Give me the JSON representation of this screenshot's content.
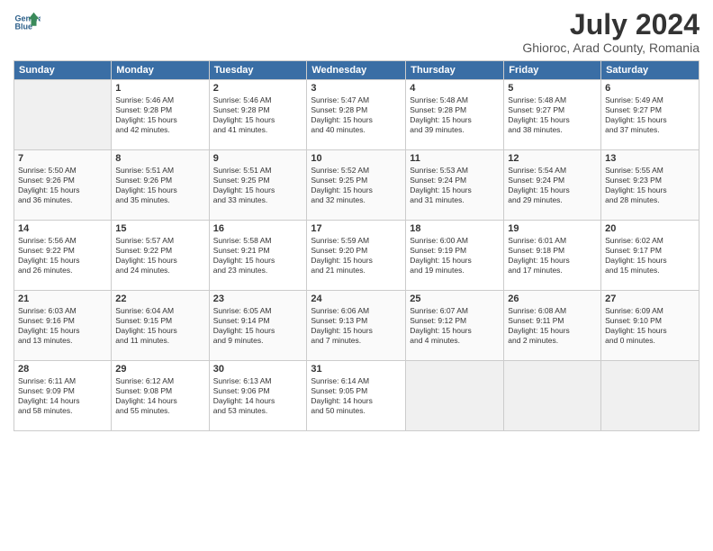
{
  "header": {
    "logo_line1": "General",
    "logo_line2": "Blue",
    "title": "July 2024",
    "subtitle": "Ghioroc, Arad County, Romania"
  },
  "days_of_week": [
    "Sunday",
    "Monday",
    "Tuesday",
    "Wednesday",
    "Thursday",
    "Friday",
    "Saturday"
  ],
  "weeks": [
    [
      {
        "day": "",
        "info": ""
      },
      {
        "day": "1",
        "info": "Sunrise: 5:46 AM\nSunset: 9:28 PM\nDaylight: 15 hours\nand 42 minutes."
      },
      {
        "day": "2",
        "info": "Sunrise: 5:46 AM\nSunset: 9:28 PM\nDaylight: 15 hours\nand 41 minutes."
      },
      {
        "day": "3",
        "info": "Sunrise: 5:47 AM\nSunset: 9:28 PM\nDaylight: 15 hours\nand 40 minutes."
      },
      {
        "day": "4",
        "info": "Sunrise: 5:48 AM\nSunset: 9:28 PM\nDaylight: 15 hours\nand 39 minutes."
      },
      {
        "day": "5",
        "info": "Sunrise: 5:48 AM\nSunset: 9:27 PM\nDaylight: 15 hours\nand 38 minutes."
      },
      {
        "day": "6",
        "info": "Sunrise: 5:49 AM\nSunset: 9:27 PM\nDaylight: 15 hours\nand 37 minutes."
      }
    ],
    [
      {
        "day": "7",
        "info": "Sunrise: 5:50 AM\nSunset: 9:26 PM\nDaylight: 15 hours\nand 36 minutes."
      },
      {
        "day": "8",
        "info": "Sunrise: 5:51 AM\nSunset: 9:26 PM\nDaylight: 15 hours\nand 35 minutes."
      },
      {
        "day": "9",
        "info": "Sunrise: 5:51 AM\nSunset: 9:25 PM\nDaylight: 15 hours\nand 33 minutes."
      },
      {
        "day": "10",
        "info": "Sunrise: 5:52 AM\nSunset: 9:25 PM\nDaylight: 15 hours\nand 32 minutes."
      },
      {
        "day": "11",
        "info": "Sunrise: 5:53 AM\nSunset: 9:24 PM\nDaylight: 15 hours\nand 31 minutes."
      },
      {
        "day": "12",
        "info": "Sunrise: 5:54 AM\nSunset: 9:24 PM\nDaylight: 15 hours\nand 29 minutes."
      },
      {
        "day": "13",
        "info": "Sunrise: 5:55 AM\nSunset: 9:23 PM\nDaylight: 15 hours\nand 28 minutes."
      }
    ],
    [
      {
        "day": "14",
        "info": "Sunrise: 5:56 AM\nSunset: 9:22 PM\nDaylight: 15 hours\nand 26 minutes."
      },
      {
        "day": "15",
        "info": "Sunrise: 5:57 AM\nSunset: 9:22 PM\nDaylight: 15 hours\nand 24 minutes."
      },
      {
        "day": "16",
        "info": "Sunrise: 5:58 AM\nSunset: 9:21 PM\nDaylight: 15 hours\nand 23 minutes."
      },
      {
        "day": "17",
        "info": "Sunrise: 5:59 AM\nSunset: 9:20 PM\nDaylight: 15 hours\nand 21 minutes."
      },
      {
        "day": "18",
        "info": "Sunrise: 6:00 AM\nSunset: 9:19 PM\nDaylight: 15 hours\nand 19 minutes."
      },
      {
        "day": "19",
        "info": "Sunrise: 6:01 AM\nSunset: 9:18 PM\nDaylight: 15 hours\nand 17 minutes."
      },
      {
        "day": "20",
        "info": "Sunrise: 6:02 AM\nSunset: 9:17 PM\nDaylight: 15 hours\nand 15 minutes."
      }
    ],
    [
      {
        "day": "21",
        "info": "Sunrise: 6:03 AM\nSunset: 9:16 PM\nDaylight: 15 hours\nand 13 minutes."
      },
      {
        "day": "22",
        "info": "Sunrise: 6:04 AM\nSunset: 9:15 PM\nDaylight: 15 hours\nand 11 minutes."
      },
      {
        "day": "23",
        "info": "Sunrise: 6:05 AM\nSunset: 9:14 PM\nDaylight: 15 hours\nand 9 minutes."
      },
      {
        "day": "24",
        "info": "Sunrise: 6:06 AM\nSunset: 9:13 PM\nDaylight: 15 hours\nand 7 minutes."
      },
      {
        "day": "25",
        "info": "Sunrise: 6:07 AM\nSunset: 9:12 PM\nDaylight: 15 hours\nand 4 minutes."
      },
      {
        "day": "26",
        "info": "Sunrise: 6:08 AM\nSunset: 9:11 PM\nDaylight: 15 hours\nand 2 minutes."
      },
      {
        "day": "27",
        "info": "Sunrise: 6:09 AM\nSunset: 9:10 PM\nDaylight: 15 hours\nand 0 minutes."
      }
    ],
    [
      {
        "day": "28",
        "info": "Sunrise: 6:11 AM\nSunset: 9:09 PM\nDaylight: 14 hours\nand 58 minutes."
      },
      {
        "day": "29",
        "info": "Sunrise: 6:12 AM\nSunset: 9:08 PM\nDaylight: 14 hours\nand 55 minutes."
      },
      {
        "day": "30",
        "info": "Sunrise: 6:13 AM\nSunset: 9:06 PM\nDaylight: 14 hours\nand 53 minutes."
      },
      {
        "day": "31",
        "info": "Sunrise: 6:14 AM\nSunset: 9:05 PM\nDaylight: 14 hours\nand 50 minutes."
      },
      {
        "day": "",
        "info": ""
      },
      {
        "day": "",
        "info": ""
      },
      {
        "day": "",
        "info": ""
      }
    ]
  ]
}
